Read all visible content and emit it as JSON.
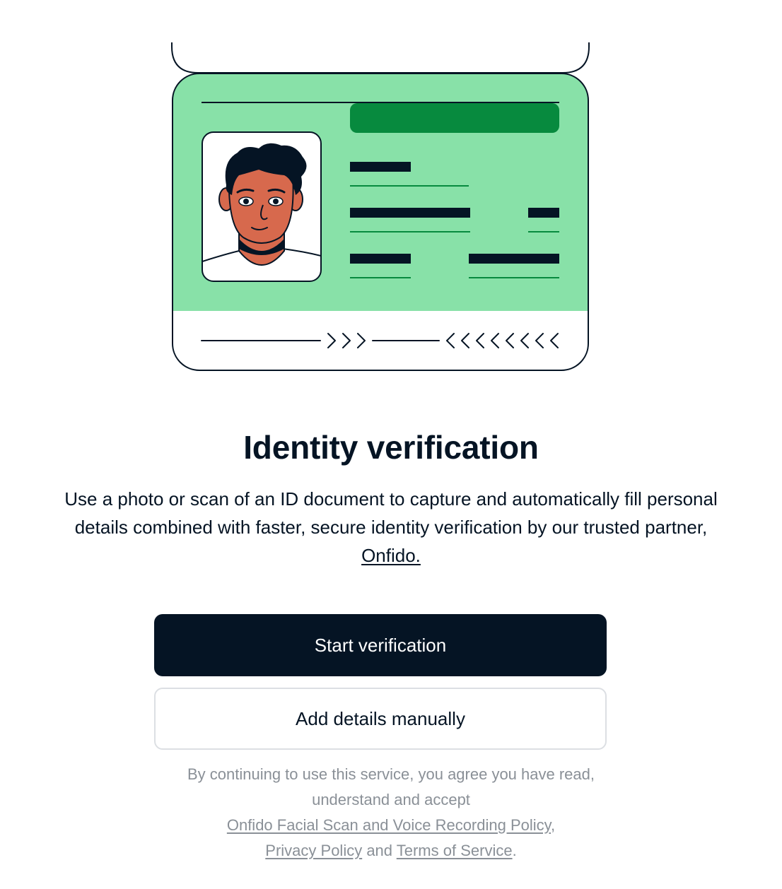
{
  "page": {
    "title": "Identity verification",
    "description_prefix": "Use a photo or scan of an ID document to capture and automatically fill personal details combined with faster, secure identity verification by our trusted partner, ",
    "partner_link": "Onfido."
  },
  "buttons": {
    "start": "Start verification",
    "manual": "Add details manually"
  },
  "legal": {
    "line1": "By continuing to use this service, you agree you have read,",
    "line2": "understand and accept",
    "facial_policy_link": "Onfido Facial Scan and Voice Recording Policy",
    "comma": ",",
    "privacy_link": "Privacy Policy",
    "and": " and ",
    "terms_link": "Terms of Service",
    "period": "."
  },
  "illustration": {
    "icon": "id-card-illustration",
    "colors": {
      "card_green": "#88E1A8",
      "badge_green": "#078A3E",
      "ink": "#051424",
      "skin": "#D7694D"
    }
  }
}
